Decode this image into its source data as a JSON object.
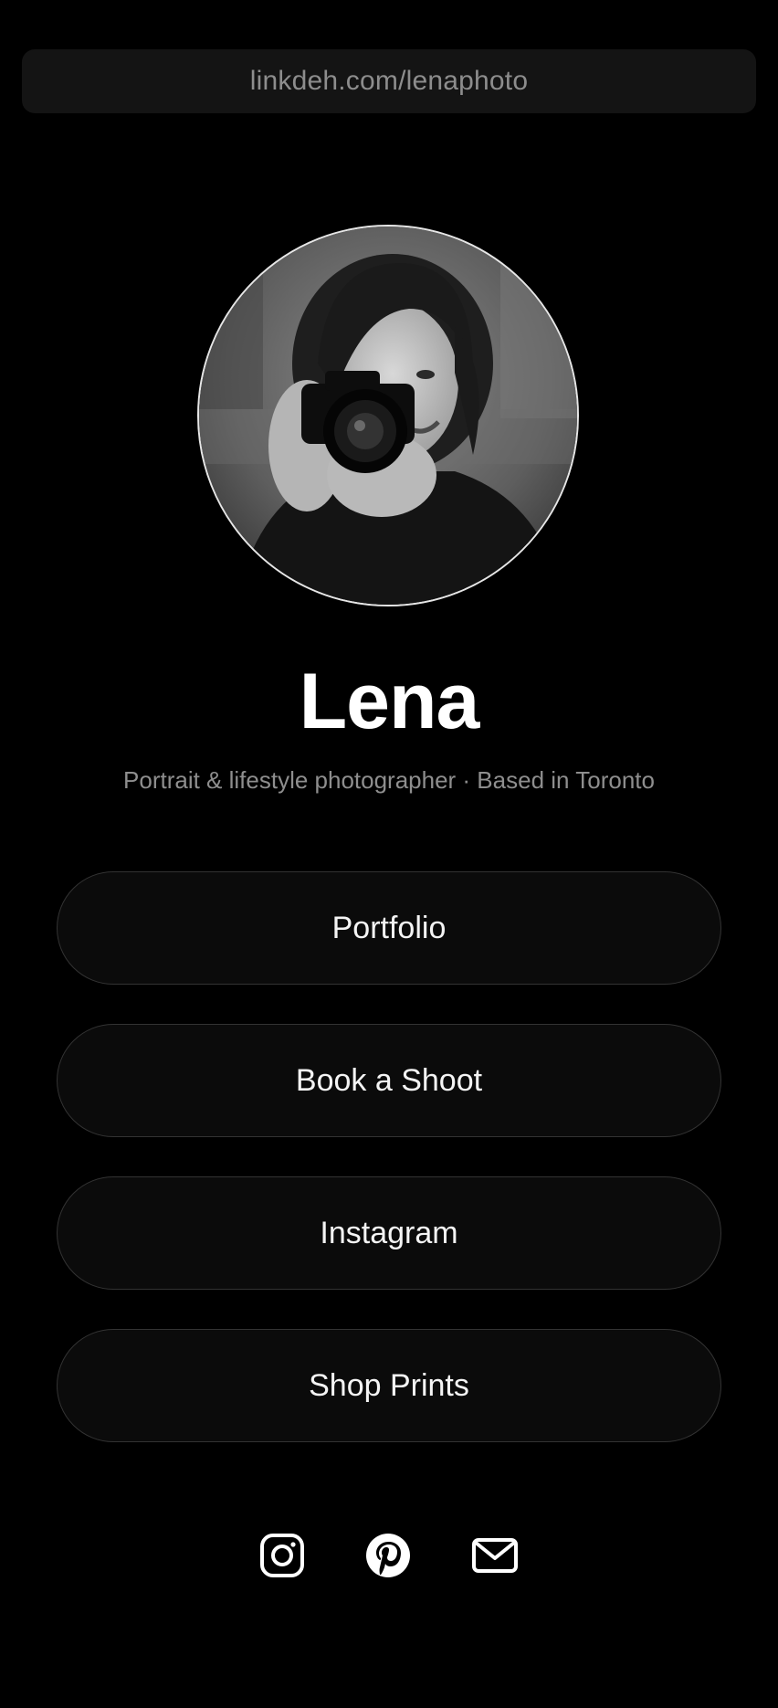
{
  "url_bar": {
    "text": "linkdeh.com/lenaphoto"
  },
  "profile": {
    "name": "Lena",
    "bio": "Portrait & lifestyle photographer · Based in Toronto",
    "avatar_icon": "profile-photo-woman-with-camera"
  },
  "links": [
    {
      "label": "Portfolio"
    },
    {
      "label": "Book a Shoot"
    },
    {
      "label": "Instagram"
    },
    {
      "label": "Shop Prints"
    }
  ],
  "socials": [
    {
      "icon": "instagram-icon"
    },
    {
      "icon": "pinterest-icon"
    },
    {
      "icon": "mail-icon"
    }
  ],
  "colors": {
    "background": "#000000",
    "button_fill": "#0b0b0b",
    "button_border": "#333333",
    "muted_text": "#8e8e8e",
    "text": "#ffffff"
  }
}
